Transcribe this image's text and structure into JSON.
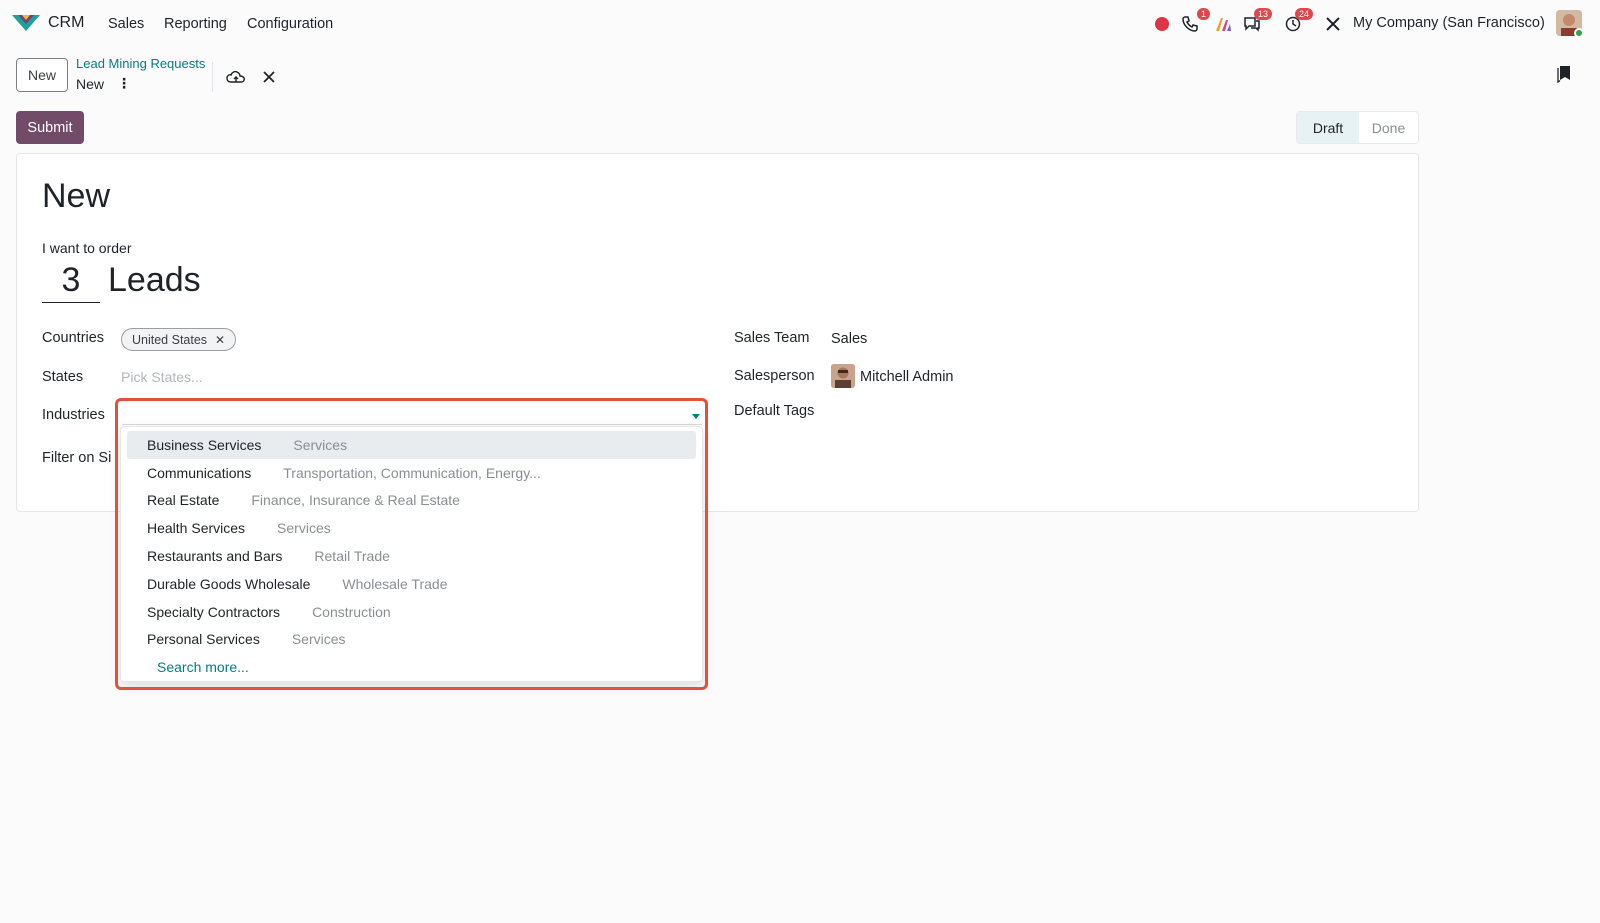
{
  "navbar": {
    "app_name": "CRM",
    "menus": [
      "Sales",
      "Reporting",
      "Configuration"
    ],
    "badges": {
      "phone": "1",
      "messages": "13",
      "activities": "24"
    },
    "company": "My Company (San Francisco)"
  },
  "control_panel": {
    "new_button": "New",
    "breadcrumb_parent": "Lead Mining Requests",
    "breadcrumb_current": "New",
    "submit_button": "Submit",
    "status": [
      "Draft",
      "Done"
    ],
    "status_active": "Draft"
  },
  "form": {
    "record_name": "New",
    "order_label": "I want to order",
    "lead_count": "3",
    "lead_unit": "Leads",
    "countries_label": "Countries",
    "country_tag": "United States",
    "states_label": "States",
    "states_placeholder": "Pick States...",
    "industries_label": "Industries",
    "filter_label": "Filter on Si",
    "sales_team_label": "Sales Team",
    "sales_team_value": "Sales",
    "salesperson_label": "Salesperson",
    "salesperson_value": "Mitchell Admin",
    "default_tags_label": "Default Tags"
  },
  "dropdown": {
    "items": [
      {
        "name": "Business Services",
        "sector": "Services"
      },
      {
        "name": "Communications",
        "sector": "Transportation, Communication, Energy..."
      },
      {
        "name": "Real Estate",
        "sector": "Finance, Insurance & Real Estate"
      },
      {
        "name": "Health Services",
        "sector": "Services"
      },
      {
        "name": "Restaurants and Bars",
        "sector": "Retail Trade"
      },
      {
        "name": "Durable Goods Wholesale",
        "sector": "Wholesale Trade"
      },
      {
        "name": "Specialty Contractors",
        "sector": "Construction"
      },
      {
        "name": "Personal Services",
        "sector": "Services"
      }
    ],
    "search_more": "Search more..."
  },
  "colors": {
    "accent": "#714b67",
    "link": "#017e84",
    "highlight": "#e0533a"
  }
}
